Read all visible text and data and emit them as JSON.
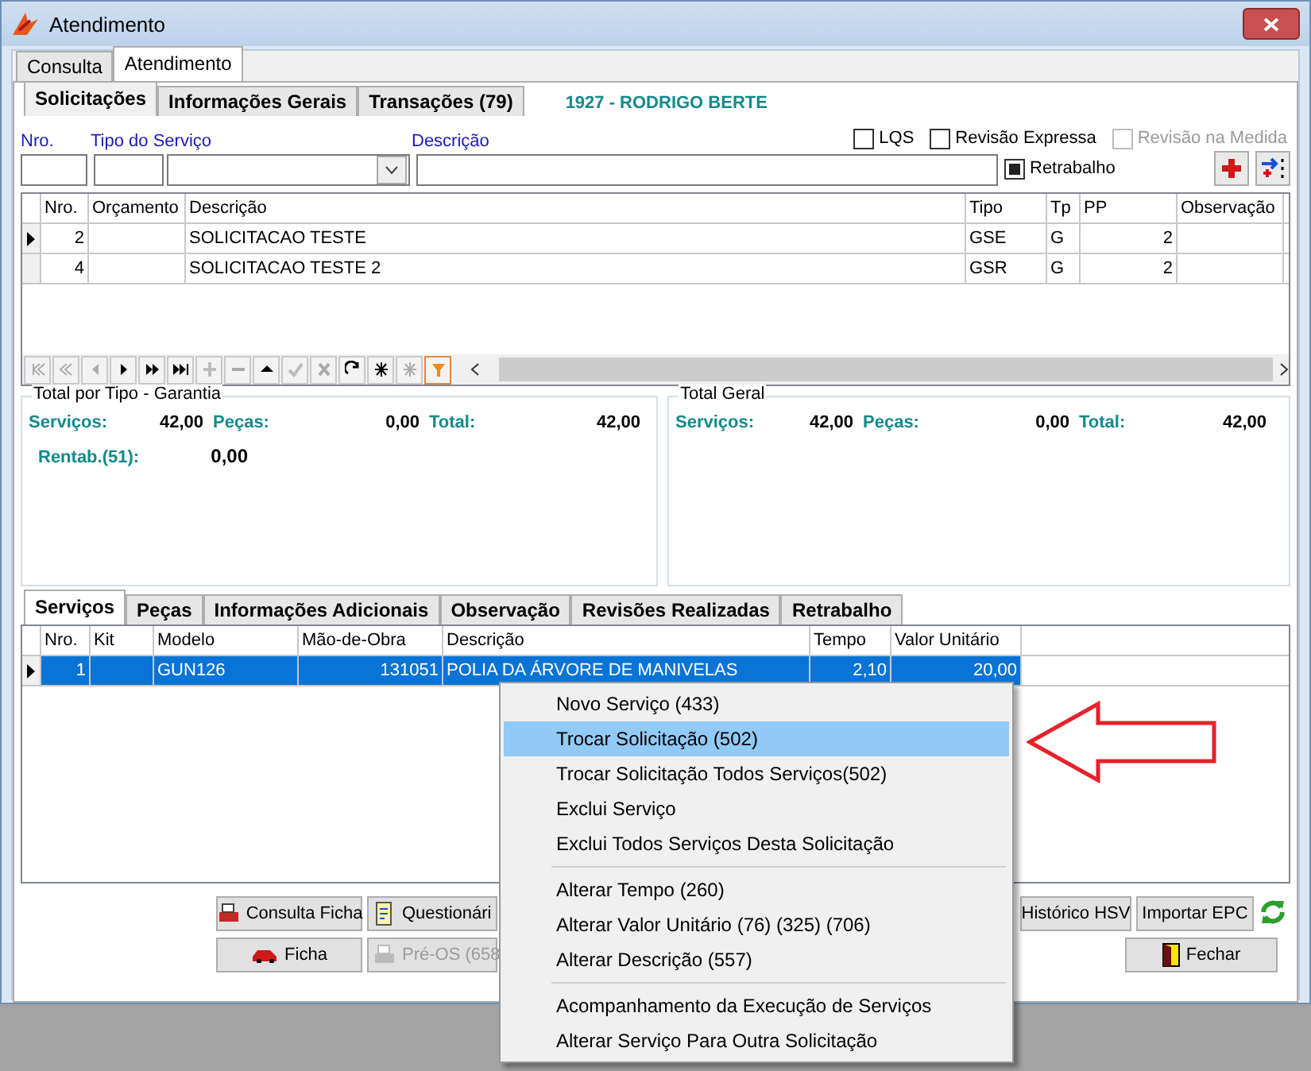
{
  "window": {
    "title": "Atendimento"
  },
  "main_tabs": [
    {
      "label": "Consulta",
      "selected": false
    },
    {
      "label": "Atendimento",
      "selected": true
    }
  ],
  "sub_tabs": [
    {
      "label": "Solicitações",
      "selected": true
    },
    {
      "label": "Informações Gerais",
      "selected": false
    },
    {
      "label": "Transações (79)",
      "selected": false
    }
  ],
  "customer": "1927 - RODRIGO BERTE",
  "form": {
    "labels": [
      "Nro.",
      "Tipo do Serviço",
      "Descrição"
    ],
    "options": [
      {
        "label": "LQS",
        "checked": false,
        "disabled": false
      },
      {
        "label": "Revisão Expressa",
        "checked": false,
        "disabled": false
      },
      {
        "label": "Revisão na Medida",
        "checked": false,
        "disabled": true
      }
    ],
    "retrabalho": {
      "label": "Retrabalho",
      "checked": true
    }
  },
  "solicitacoes": {
    "columns": [
      "Nro.",
      "Orçamento",
      "Descrição",
      "Tipo",
      "Tp",
      "PP",
      "Observação"
    ],
    "rows": [
      {
        "selected": true,
        "cells": [
          "2",
          "",
          "SOLICITACAO TESTE",
          "GSE",
          "G",
          "2",
          ""
        ]
      },
      {
        "selected": false,
        "cells": [
          "4",
          "",
          "SOLICITACAO TESTE 2",
          "GSR",
          "G",
          "2",
          ""
        ]
      }
    ]
  },
  "totals": [
    {
      "title": "Total por Tipo - Garantia",
      "items": [
        {
          "label": "Serviços:",
          "value": "42,00"
        },
        {
          "label": "Peças:",
          "value": "0,00"
        },
        {
          "label": "Total:",
          "value": "42,00"
        }
      ],
      "extra": {
        "label": "Rentab.(51):",
        "value": "0,00"
      }
    },
    {
      "title": "Total Geral",
      "items": [
        {
          "label": "Serviços:",
          "value": "42,00"
        },
        {
          "label": "Peças:",
          "value": "0,00"
        },
        {
          "label": "Total:",
          "value": "42,00"
        }
      ]
    }
  ],
  "service_tabs": [
    {
      "label": "Serviços",
      "selected": true
    },
    {
      "label": "Peças",
      "selected": false
    },
    {
      "label": "Informações Adicionais",
      "selected": false
    },
    {
      "label": "Observação",
      "selected": false
    },
    {
      "label": "Revisões Realizadas",
      "selected": false
    },
    {
      "label": "Retrabalho",
      "selected": false
    }
  ],
  "servicos": {
    "columns": [
      "Nro.",
      "Kit",
      "Modelo",
      "Mão-de-Obra",
      "Descrição",
      "Tempo",
      "Valor Unitário"
    ],
    "rows": [
      {
        "selected": true,
        "cells": [
          "1",
          "",
          "GUN126",
          "131051",
          "POLIA DA ÁRVORE DE MANIVELAS",
          "2,10",
          "20,00"
        ]
      }
    ]
  },
  "buttons": [
    [
      {
        "label": "Consulta Ficha",
        "kind": "printer",
        "disabled": false
      },
      {
        "label": "Questionári",
        "kind": "form",
        "disabled": false
      },
      {
        "label": "Histórico HSV",
        "kind": "plain",
        "disabled": false
      },
      {
        "label": "Importar EPC",
        "kind": "plain",
        "disabled": false
      }
    ],
    [
      {
        "label": "Ficha",
        "kind": "car",
        "disabled": false
      },
      {
        "label": "Pré-OS (658",
        "kind": "printer",
        "disabled": true
      },
      {
        "label": "Fechar",
        "kind": "door",
        "disabled": false
      }
    ]
  ],
  "context_menu": [
    [
      {
        "label": "Novo Serviço (433)",
        "selected": false
      },
      {
        "label": "Trocar Solicitação (502)",
        "selected": true
      },
      {
        "label": "Trocar Solicitação Todos Serviços(502)",
        "selected": false
      },
      {
        "label": "Exclui Serviço",
        "selected": false
      },
      {
        "label": "Exclui Todos Serviços Desta Solicitação",
        "selected": false
      }
    ],
    [
      {
        "label": "Alterar Tempo (260)",
        "selected": false
      },
      {
        "label": "Alterar Valor Unitário (76) (325) (706)",
        "selected": false
      },
      {
        "label": "Alterar Descrição (557)",
        "selected": false
      }
    ],
    [
      {
        "label": "Acompanhamento da Execução de Serviços",
        "selected": false
      },
      {
        "label": "Alterar Serviço Para Outra Solicitação",
        "selected": false
      }
    ]
  ]
}
